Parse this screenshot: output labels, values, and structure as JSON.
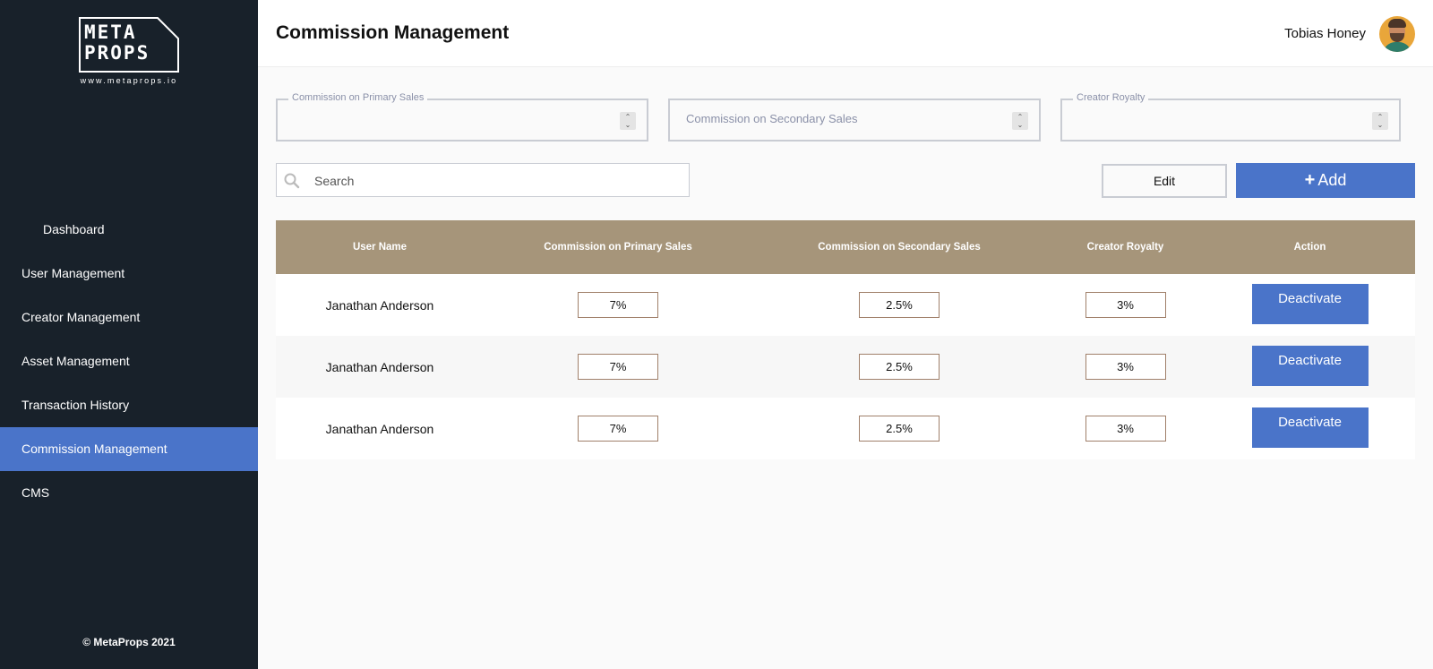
{
  "sidebar": {
    "logo": {
      "line1": "META",
      "line2": "PROPS",
      "url": "www.metaprops.io"
    },
    "items": [
      {
        "label": "Dashboard"
      },
      {
        "label": "User Management"
      },
      {
        "label": "Creator Management"
      },
      {
        "label": "Asset Management"
      },
      {
        "label": "Transaction History"
      },
      {
        "label": "Commission Management",
        "active": true
      },
      {
        "label": "CMS"
      }
    ],
    "copyright": "© MetaProps 2021"
  },
  "header": {
    "title": "Commission Management",
    "user_name": "Tobias Honey",
    "avatar_icon": "user-avatar"
  },
  "fields": {
    "primary": {
      "legend": "Commission on Primary Sales",
      "value": ""
    },
    "secondary": {
      "placeholder": "Commission on Secondary Sales",
      "value": ""
    },
    "royalty": {
      "legend": "Creator Royalty",
      "value": ""
    }
  },
  "search": {
    "placeholder": "Search",
    "icon": "search-icon"
  },
  "buttons": {
    "edit": "Edit",
    "add": "Add",
    "add_icon": "plus-icon"
  },
  "table": {
    "columns": [
      "User Name",
      "Commission on Primary Sales",
      "Commission on Secondary Sales",
      "Creator Royalty",
      "Action"
    ],
    "rows": [
      {
        "user_name": "Janathan Anderson",
        "primary": "7%",
        "secondary": "2.5%",
        "royalty": "3%",
        "action": "Deactivate"
      },
      {
        "user_name": "Janathan Anderson",
        "primary": "7%",
        "secondary": "2.5%",
        "royalty": "3%",
        "action": "Deactivate"
      },
      {
        "user_name": "Janathan Anderson",
        "primary": "7%",
        "secondary": "2.5%",
        "royalty": "3%",
        "action": "Deactivate"
      }
    ]
  },
  "colors": {
    "sidebar_bg": "#18212a",
    "accent_blue": "#4a74c9",
    "table_header": "#a6957a",
    "value_border": "#a0806a"
  }
}
